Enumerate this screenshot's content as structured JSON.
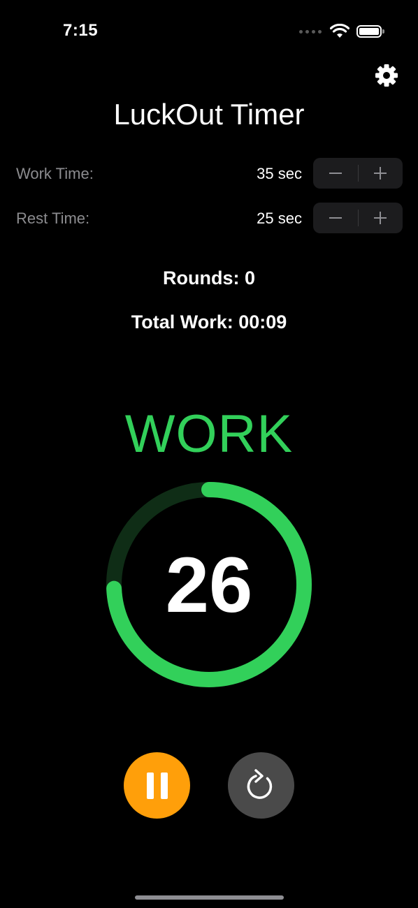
{
  "status_bar": {
    "time": "7:15",
    "wifi_icon": "wifi-icon",
    "battery_icon": "battery-icon"
  },
  "header": {
    "title": "LuckOut Timer",
    "settings_icon": "gear-icon"
  },
  "settings": {
    "work_time": {
      "label": "Work Time:",
      "value": "35 sec",
      "decrement": "−",
      "increment": "+"
    },
    "rest_time": {
      "label": "Rest Time:",
      "value": "25 sec",
      "decrement": "−",
      "increment": "+"
    }
  },
  "stats": {
    "rounds": "Rounds: 0",
    "total_work": "Total Work: 00:09"
  },
  "timer": {
    "phase": "WORK",
    "seconds_remaining": "26",
    "progress_fraction": 0.743
  },
  "controls": {
    "pause_icon": "pause-icon",
    "reset_icon": "reset-icon"
  },
  "colors": {
    "background": "#000000",
    "accent_work": "#32d05a",
    "ring_track": "#0f2d16",
    "pause_button": "#ff9f0a",
    "reset_button": "#4a4a4a",
    "label_gray": "#8c8c8f",
    "stepper_bg": "#1c1c1e"
  }
}
